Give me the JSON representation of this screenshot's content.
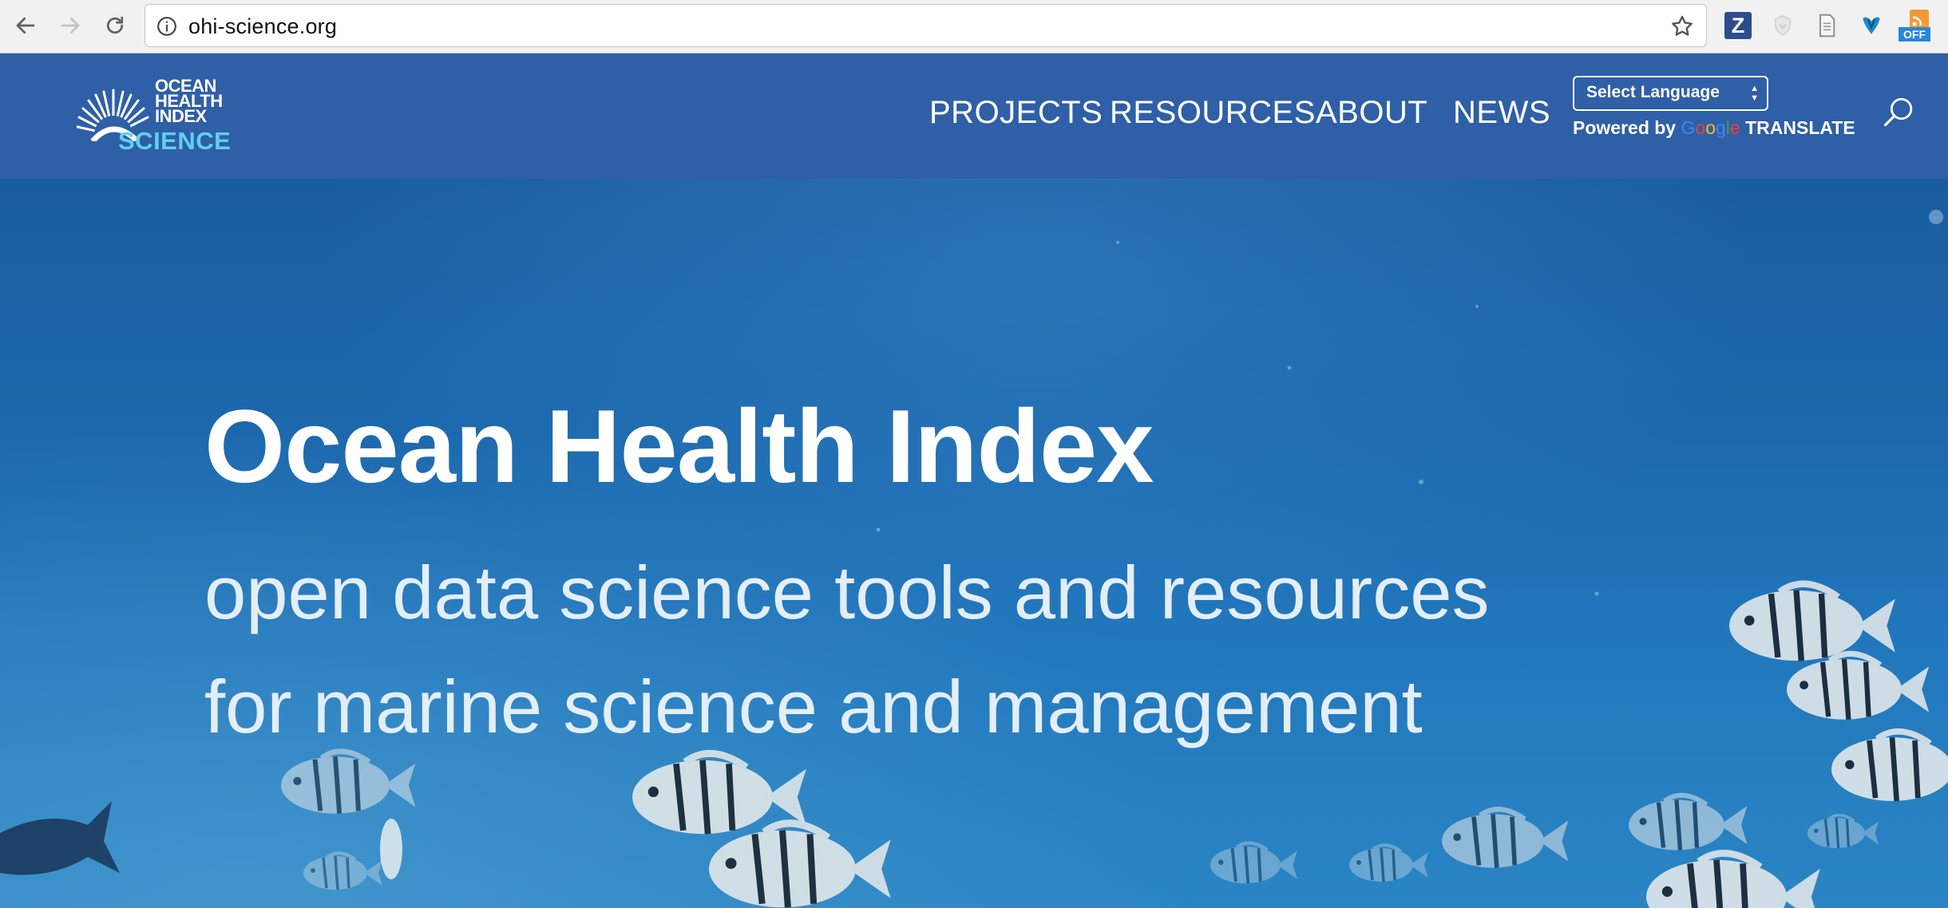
{
  "browser": {
    "url": "ohi-science.org",
    "extensions": {
      "z_label": "Z",
      "off_label": "OFF"
    }
  },
  "site": {
    "logo": {
      "line1": "OCEAN",
      "line2": "HEALTH",
      "line3": "INDEX",
      "line4": "SCIENCE"
    },
    "nav": [
      "PROJECTS",
      "RESOURCES",
      "ABOUT",
      "NEWS"
    ],
    "language_select": "Select Language",
    "powered_by": "Powered by",
    "google": "Google",
    "translate": "TRANSLATE"
  },
  "hero": {
    "title": "Ocean Health Index",
    "subtitle_line1": "open data science tools and resources",
    "subtitle_line2": "for marine science and management"
  },
  "colors": {
    "header_bg": "#2f5fa6",
    "logo_accent": "#5fd0f0",
    "ocean": "#1c68ad"
  }
}
